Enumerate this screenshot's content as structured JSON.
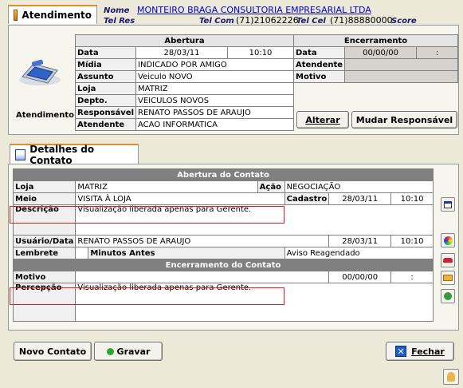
{
  "top_tab": {
    "label": "Atendimento"
  },
  "header": {
    "nome_label": "Nome",
    "nome_value": "MONTEIRO BRAGA CONSULTORIA EMPRESARIAL LTDA",
    "telres_label": "Tel Res",
    "telcom_label": "Tel Com",
    "telcom_value": "(71)21062226",
    "telcel_label": "Tel Cel",
    "telcel_value": "(71)88880000",
    "score_label": "Score"
  },
  "atendimento": {
    "icon_caption": "Atendimento",
    "abertura_title": "Abertura",
    "encerramento_title": "Encerramento",
    "data_label": "Data",
    "data_value": "28/03/11",
    "hora_value": "10:10",
    "midia_label": "Mídia",
    "midia_value": "INDICADO POR AMIGO",
    "assunto_label": "Assunto",
    "assunto_value": "Veiculo NOVO",
    "loja_label": "Loja",
    "loja_value": "MATRIZ",
    "depto_label": "Depto.",
    "depto_value": "VEICULOS NOVOS",
    "responsavel_label": "Responsável",
    "responsavel_value": "RENATO PASSOS DE ARAUJO",
    "atendente_label": "Atendente",
    "atendente_value": "ACAO INFORMATICA",
    "enc_data_label": "Data",
    "enc_data_value": "00/00/00",
    "enc_hora_value": ":",
    "enc_atendente_label": "Atendente",
    "enc_motivo_label": "Motivo",
    "alterar_button": "Alterar",
    "mudar_button": "Mudar Responsável"
  },
  "detalhes_tab": {
    "label": "Detalhes do Contato"
  },
  "contato": {
    "abertura_title": "Abertura do Contato",
    "loja_label": "Loja",
    "loja_value": "MATRIZ",
    "acao_label": "Ação",
    "acao_value": "NEGOCIAÇÃO",
    "meio_label": "Meio",
    "meio_value": "VISITA À LOJA",
    "cadastro_label": "Cadastro",
    "cadastro_data": "28/03/11",
    "cadastro_hora": "10:10",
    "descricao_label": "Descrição",
    "descricao_value": "Visualização liberada apenas para Gerente.",
    "usuario_label": "Usuário/Data",
    "usuario_value": "RENATO PASSOS DE ARAUJO",
    "usuario_data": "28/03/11",
    "usuario_hora": "10:10",
    "lembrete_label": "Lembrete",
    "minutos_label": "Minutos Antes",
    "aviso_value": "Aviso Reagendado",
    "encerramento_title": "Encerramento do Contato",
    "motivo_label": "Motivo",
    "motivo_data": "00/00/00",
    "motivo_hora": ":",
    "percepcao_label": "Percepção",
    "percepcao_value": "Visualização liberada apenas para Gerente."
  },
  "footer": {
    "novo_contato": "Novo Contato",
    "gravar": "Gravar",
    "fechar": "Fechar"
  }
}
